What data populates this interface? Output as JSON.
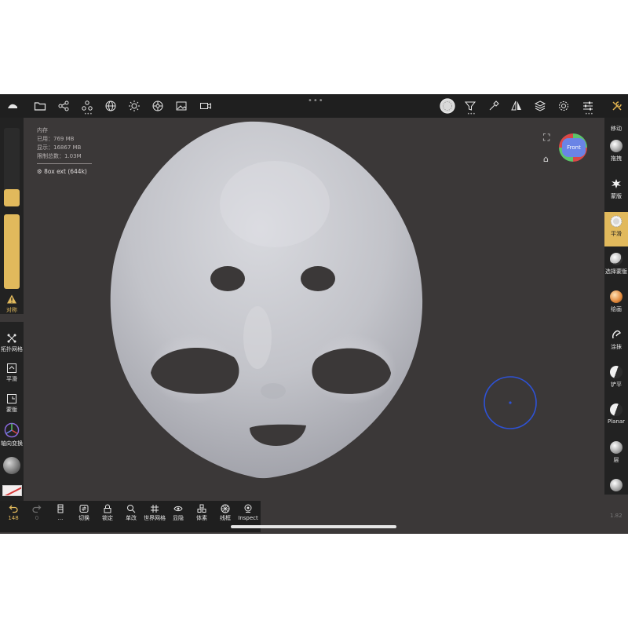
{
  "top_toolbar": {
    "left_icons": [
      "scene-logo-icon",
      "folder-icon",
      "share-graph-icon",
      "mesh-icon",
      "globe-icon",
      "sun-icon",
      "shading-icon",
      "image-icon",
      "camera-icon"
    ],
    "handle": "•••",
    "right_icons": [
      "brush-alpha-icon",
      "filter-icon",
      "paint-icon",
      "symmetry-icon",
      "layers-icon",
      "settings-icon",
      "sliders-icon",
      "wrench-icon"
    ]
  },
  "stats": {
    "title": "内存",
    "used": "已用：769 MB",
    "vertices": "显示：16867 MB",
    "limit": "限制总数：1.03M",
    "mesh_label": "8ox ext (644k)"
  },
  "left_panel": {
    "symmetry_label": "对称",
    "buttons": [
      {
        "icon": "topology-icon",
        "label": "拓扑网格"
      },
      {
        "icon": "flatten-icon",
        "label": "平滑"
      },
      {
        "icon": "mask-icon",
        "label": "蒙版"
      },
      {
        "icon": "axis-transform-icon",
        "label": "轴向变换"
      }
    ]
  },
  "right_panel": {
    "top_label": "移动",
    "tools": [
      {
        "label": "拖拽",
        "icon": "drag-icon"
      },
      {
        "label": "蒙版",
        "icon": "mask-splat-icon"
      },
      {
        "label": "平滑",
        "icon": "smooth-icon",
        "active": true
      },
      {
        "label": "选择蒙版",
        "icon": "select-mask-icon"
      },
      {
        "label": "绘画",
        "icon": "paint-ball-icon"
      },
      {
        "label": "涂抹",
        "icon": "smudge-icon"
      },
      {
        "label": "铲平",
        "icon": "flatten-ball-icon"
      },
      {
        "label": "Planar",
        "icon": "planar-ball-icon"
      },
      {
        "label": "层",
        "icon": "layer-ball-icon"
      },
      {
        "label": "",
        "icon": "crease-ball-icon"
      }
    ],
    "zoom": "1.82"
  },
  "gizmo": {
    "face": "Front"
  },
  "bottom_bar": {
    "undo_count": "148",
    "redo_count": "0",
    "buttons": [
      {
        "icon": "stack-icon",
        "label": "..."
      },
      {
        "icon": "swap-icon",
        "label": "切换"
      },
      {
        "icon": "lock-icon",
        "label": "锁定"
      },
      {
        "icon": "magnify-icon",
        "label": "单改"
      },
      {
        "icon": "grid-icon",
        "label": "世界网格"
      },
      {
        "icon": "eye-icon",
        "label": "显隐"
      },
      {
        "icon": "voxel-icon",
        "label": "体素"
      },
      {
        "icon": "wireframe-icon",
        "label": "线框"
      },
      {
        "icon": "inspect-icon",
        "label": "Inspect"
      }
    ]
  },
  "colors": {
    "viewport": "#3b3838",
    "toolbar": "#1f1f1f",
    "accent": "#e1b95c",
    "cursor": "#2e52d6",
    "model": "#c9c9cf"
  }
}
